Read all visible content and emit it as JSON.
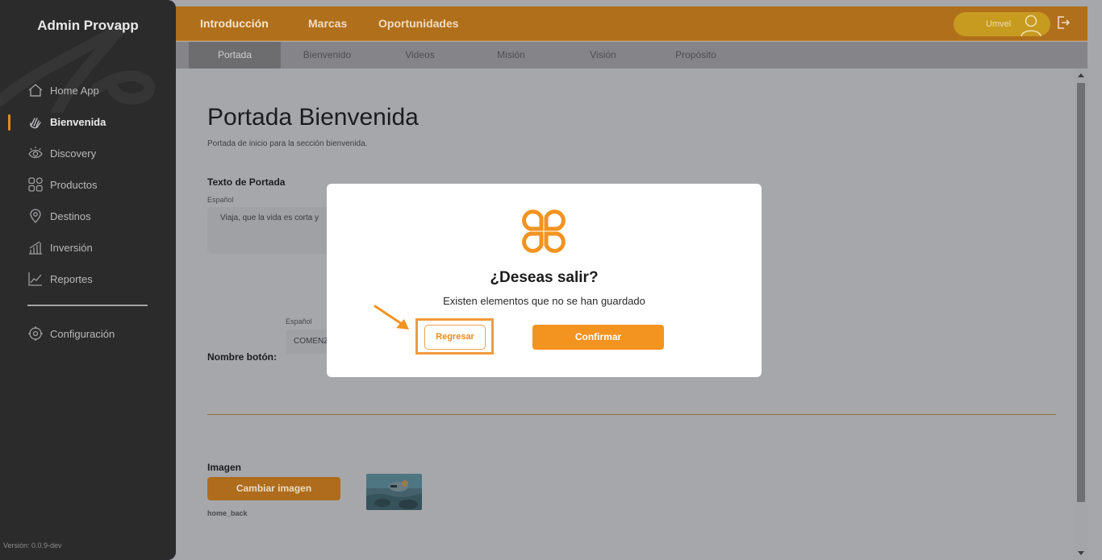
{
  "app": {
    "brand": "Admin Provapp",
    "version": "Versión: 0.0.9-dev"
  },
  "header": {
    "tabs": [
      {
        "label": "Introducción",
        "active": true
      },
      {
        "label": "Marcas",
        "active": false
      },
      {
        "label": "Oportunidades",
        "active": false
      }
    ],
    "user_name": "Umvel"
  },
  "subnav": {
    "tabs": [
      {
        "label": "Portada",
        "active": true
      },
      {
        "label": "Bienvenido",
        "active": false
      },
      {
        "label": "Videos",
        "active": false
      },
      {
        "label": "Misión",
        "active": false
      },
      {
        "label": "Visión",
        "active": false
      },
      {
        "label": "Propósito",
        "active": false
      }
    ]
  },
  "sidebar": {
    "items": [
      {
        "label": "Home App",
        "icon": "home-icon",
        "active": false
      },
      {
        "label": "Bienvenida",
        "icon": "wave-hand-icon",
        "active": true
      },
      {
        "label": "Discovery",
        "icon": "eye-icon",
        "active": false
      },
      {
        "label": "Productos",
        "icon": "grid-icon",
        "active": false
      },
      {
        "label": "Destinos",
        "icon": "location-pin-icon",
        "active": false
      },
      {
        "label": "Inversión",
        "icon": "bar-chart-icon",
        "active": false
      },
      {
        "label": "Reportes",
        "icon": "trend-chart-icon",
        "active": false
      }
    ],
    "settings": {
      "label": "Configuración",
      "icon": "gear-icon"
    }
  },
  "main": {
    "title": "Portada Bienvenida",
    "subtitle": "Portada de inicio para la sección bienvenida.",
    "cover_text_label": "Texto de Portada",
    "lang_label": "Español",
    "cover_text_value": "Viaja, que la vida es corta y",
    "button_name_label": "Nombre botón:",
    "button_lang_label": "Español",
    "button_value": "COMENZ",
    "image_label": "Imagen",
    "change_image_button": "Cambiar imagen",
    "image_filename": "home_back"
  },
  "modal": {
    "title": "¿Deseas salir?",
    "message": "Existen elementos que no se han guardado",
    "back_button": "Regresar",
    "confirm_button": "Confirmar"
  },
  "colors": {
    "accent": "#f39320",
    "header_dimmed": "#b06f1b",
    "sidebar_bg": "#2b2b2c",
    "highlight": "#f29a3d"
  }
}
